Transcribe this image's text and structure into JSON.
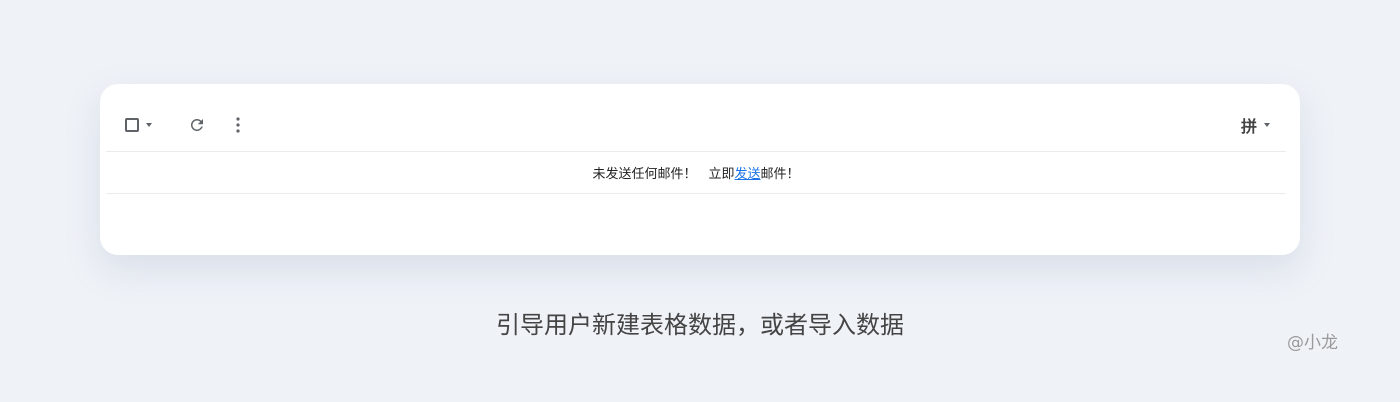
{
  "toolbar": {
    "select_icon": "checkbox-icon",
    "select_menu_icon": "caret-down-icon",
    "refresh_icon": "refresh-icon",
    "more_icon": "more-vert-icon",
    "ime_label": "拼",
    "ime_menu_icon": "caret-down-icon"
  },
  "notice": {
    "prefix": "未发送任何邮件！",
    "action_prefix": "立即",
    "action_link": "发送",
    "action_suffix": "邮件！"
  },
  "caption": "引导用户新建表格数据，或者导入数据",
  "watermark": "@小龙",
  "colors": {
    "background": "#eff2f7",
    "card": "#ffffff",
    "link": "#1a73e8",
    "icon": "#5f6368"
  }
}
